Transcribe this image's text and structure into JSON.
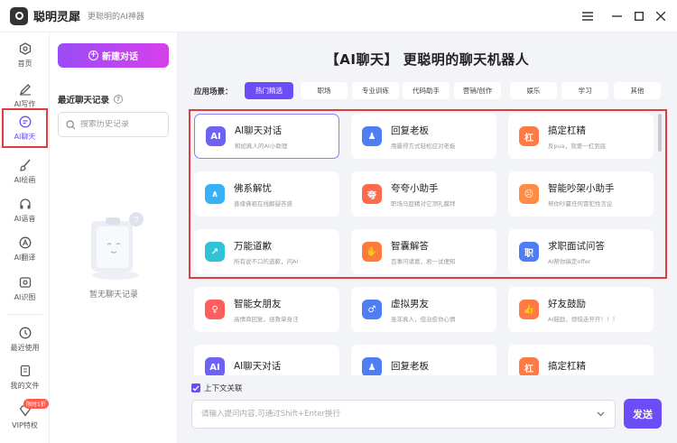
{
  "app": {
    "name": "聪明灵犀",
    "subtitle": "更聪明的AI神器"
  },
  "nav": [
    {
      "label": "首页",
      "icon": "hexagon-icon"
    },
    {
      "label": "AI写作",
      "icon": "pen-icon"
    },
    {
      "label": "AI聊天",
      "icon": "chat-icon",
      "active": true
    },
    {
      "label": "AI绘画",
      "icon": "brush-icon"
    },
    {
      "label": "AI语音",
      "icon": "headphones-icon"
    },
    {
      "label": "AI翻译",
      "icon": "translate-icon"
    },
    {
      "label": "AI识图",
      "icon": "image-scan-icon"
    },
    {
      "label": "最近使用",
      "icon": "clock-icon"
    },
    {
      "label": "我的文件",
      "icon": "file-icon"
    },
    {
      "label": "VIP特权",
      "icon": "diamond-icon",
      "badge": "限时1折"
    }
  ],
  "history": {
    "new_chat": "新建对话",
    "title": "最近聊天记录",
    "search_placeholder": "搜索历史记录",
    "empty": "暂无聊天记录"
  },
  "main": {
    "title": "【AI聊天】 更聪明的聊天机器人",
    "scene_label": "应用场景：",
    "tabs": [
      "热门精选",
      "职场",
      "专业训练",
      "代码助手",
      "营销/创作",
      "娱乐",
      "学习",
      "其他"
    ],
    "active_tab": 0,
    "cards": [
      {
        "title": "AI聊天对话",
        "desc": "和如真人的AI小助理",
        "color": "#6c63f5",
        "glyph": "AI",
        "selected": true
      },
      {
        "title": "回复老板",
        "desc": "用最得方式轻松应对老板",
        "color": "#4f7df3",
        "glyph": "♟"
      },
      {
        "title": "搞定杠精",
        "desc": "反pua，就要一杠到底",
        "color": "#ff7a45",
        "glyph": "杠"
      },
      {
        "title": "佛系解忧",
        "desc": "善缘佛祖在线解疑答惑",
        "color": "#38b2f5",
        "glyph": "∧"
      },
      {
        "title": "夸夸小助手",
        "desc": "职场马屁精对它顶礼膜拜",
        "color": "#ff6b4a",
        "glyph": "夸"
      },
      {
        "title": "智能吵架小助手",
        "desc": "帮你吵赢任何冒犯性言论",
        "color": "#ff8c42",
        "glyph": "☹"
      },
      {
        "title": "万能道歉",
        "desc": "所有说不口的道歉，问AI",
        "color": "#2ec4d6",
        "glyph": "↗"
      },
      {
        "title": "智囊解答",
        "desc": "百事问诸葛，君一试便知",
        "color": "#ff7b3d",
        "glyph": "✋"
      },
      {
        "title": "求职面试问答",
        "desc": "AI帮你搞定offer",
        "color": "#4f7df3",
        "glyph": "职"
      },
      {
        "title": "智能女朋友",
        "desc": "高情商回复，拯救单身汪",
        "color": "#ff5e5e",
        "glyph": "♀"
      },
      {
        "title": "虚拟男友",
        "desc": "虽非真人，但治愈你心情",
        "color": "#4f7df3",
        "glyph": "♂"
      },
      {
        "title": "好友鼓励",
        "desc": "AI鼓励，烦恼走开开！！！",
        "color": "#ff7a45",
        "glyph": "👍"
      },
      {
        "title": "AI聊天对话",
        "desc": "",
        "color": "#6c63f5",
        "glyph": "AI"
      },
      {
        "title": "回复老板",
        "desc": "",
        "color": "#4f7df3",
        "glyph": "♟"
      },
      {
        "title": "搞定杠精",
        "desc": "",
        "color": "#ff7a45",
        "glyph": "杠"
      }
    ]
  },
  "composer": {
    "context_label": "上下文关联",
    "placeholder": "请输入提问内容,可通过Shift+Enter换行",
    "send": "发送"
  }
}
